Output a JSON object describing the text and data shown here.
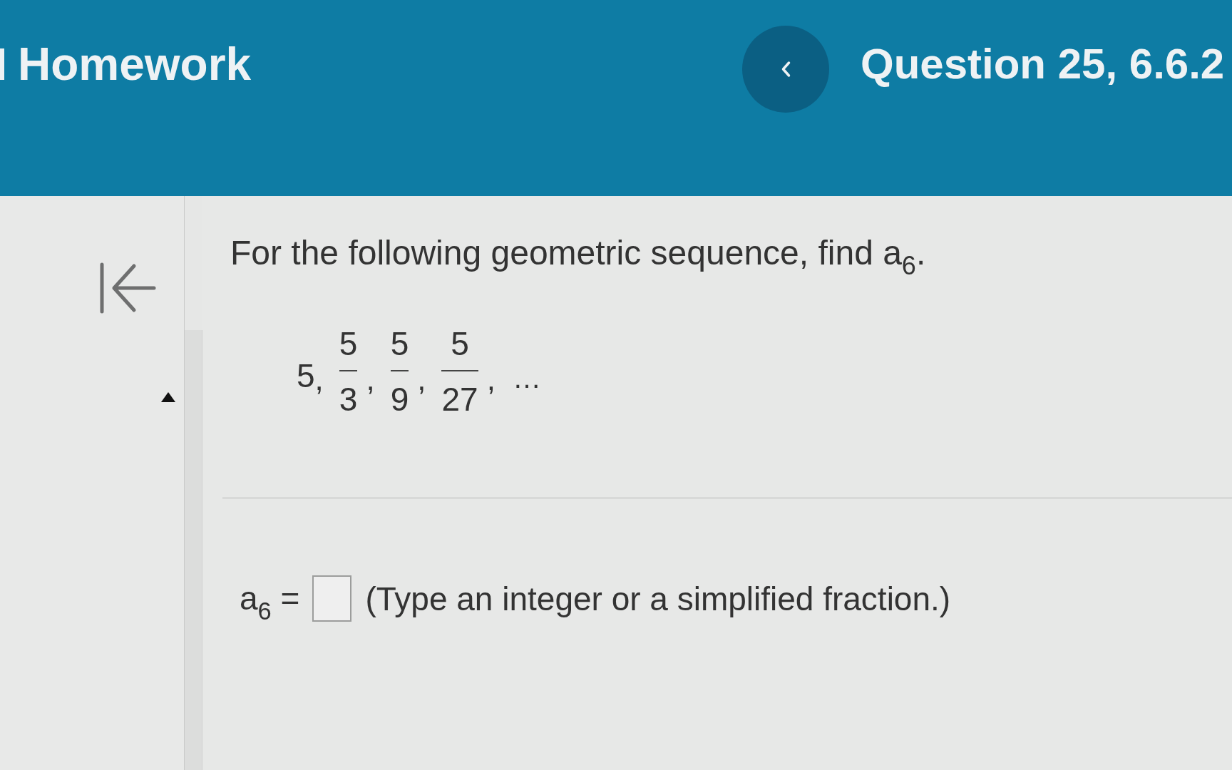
{
  "header": {
    "title": "Homework",
    "question_label": "Question 25, 6.6.2"
  },
  "question": {
    "prompt": "For the following geometric sequence, find a$_{6}$.",
    "sequence": [
      {
        "kind": "integer",
        "value": "5",
        "separator": ","
      },
      {
        "kind": "fraction",
        "numerator": "5",
        "denominator": "3",
        "separator": ","
      },
      {
        "kind": "fraction",
        "numerator": "5",
        "denominator": "9",
        "separator": ","
      },
      {
        "kind": "fraction",
        "numerator": "5",
        "denominator": "27",
        "separator": ","
      },
      {
        "kind": "ellipsis",
        "value": "…"
      }
    ]
  },
  "answer": {
    "label": "a$_{6}$ =",
    "hint": "(Type an integer or a simplified fraction.)"
  }
}
